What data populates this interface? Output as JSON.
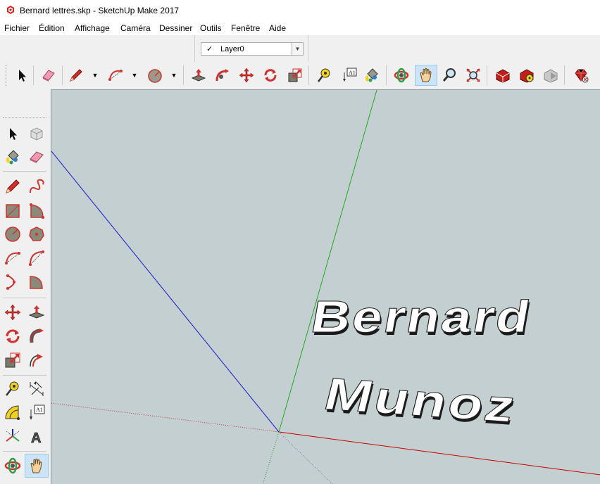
{
  "window": {
    "title": "Bernard lettres.skp - SketchUp Make 2017"
  },
  "menu": {
    "items": [
      "Fichier",
      "Édition",
      "Affichage",
      "Caméra",
      "Dessiner",
      "Outils",
      "Fenêtre",
      "Aide"
    ]
  },
  "layers": {
    "check": "✓",
    "current": "Layer0"
  },
  "toolbar": {
    "buttons": [
      "select-icon",
      "eraser-icon",
      "pencil-icon",
      "arc-icon",
      "circle-icon",
      "push-pull-icon",
      "follow-me-icon",
      "move-icon",
      "rotate-icon",
      "scale-icon",
      "tape-measure-icon",
      "text-icon",
      "paint-bucket-icon",
      "orbit-icon",
      "pan-icon",
      "zoom-icon",
      "zoom-extents-icon",
      "warehouse-icon",
      "extension-warehouse-icon",
      "share-model-icon",
      "ruby-extension-icon"
    ],
    "text_label": "A1"
  },
  "left_toolbar": {
    "text_label": "A1",
    "axis_label": "A"
  },
  "viewport": {
    "text_line1": "Bernard",
    "text_line2": "Munoz",
    "colors": {
      "background": "#c3cfd0",
      "red_axis": "#cc0000",
      "green_axis": "#22aa22",
      "blue_axis": "#1a1acc"
    }
  }
}
